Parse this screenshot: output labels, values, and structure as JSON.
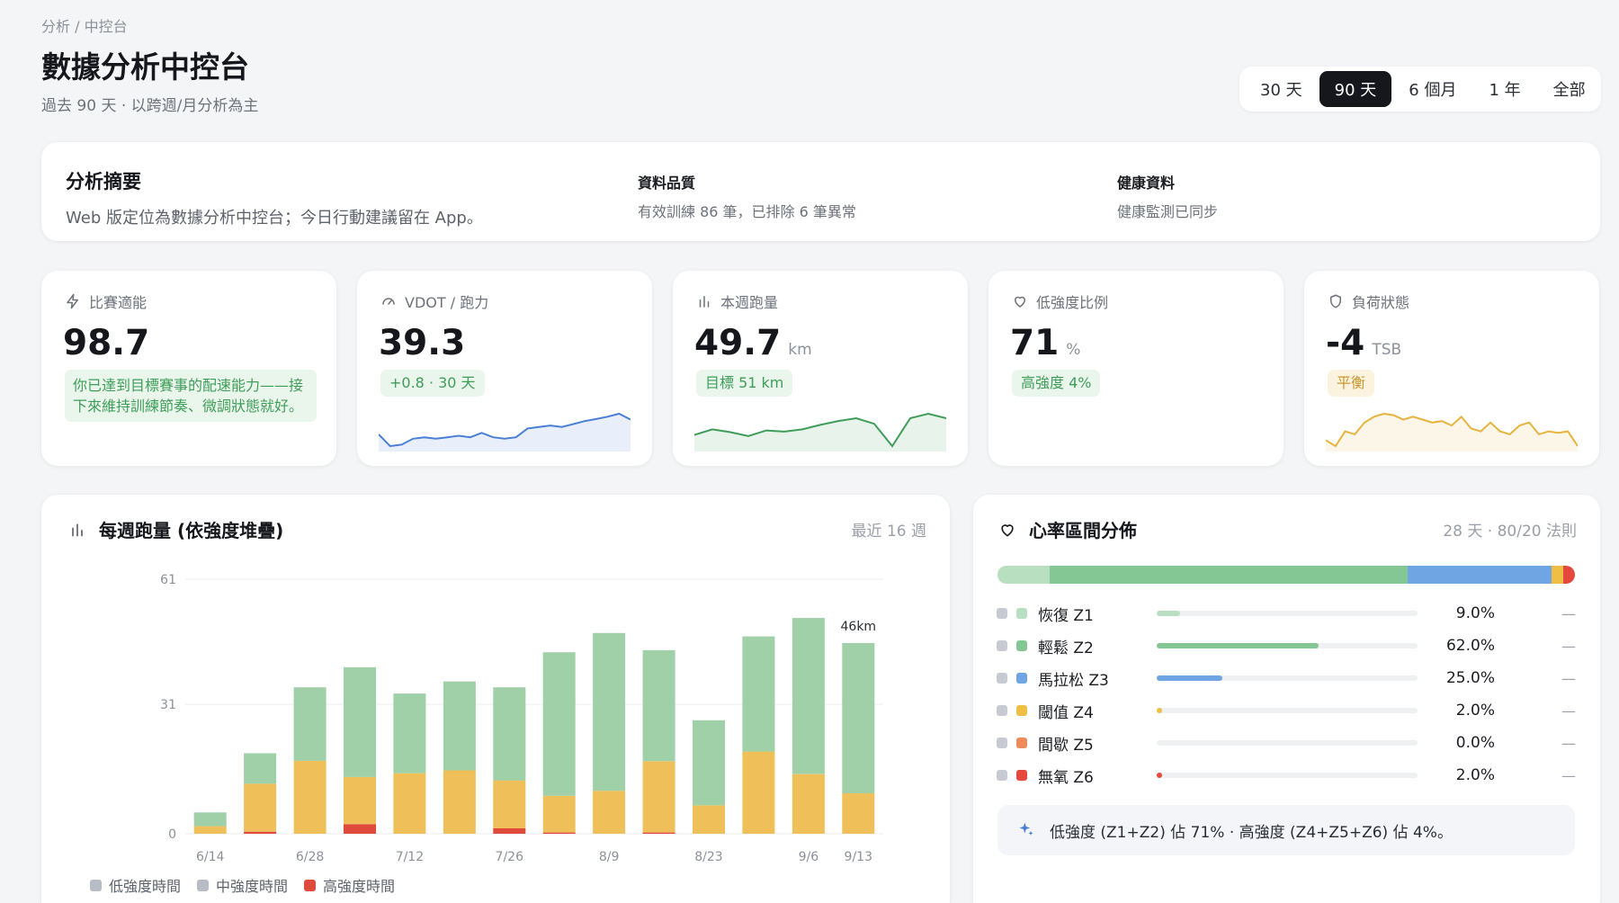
{
  "header": {
    "breadcrumb": "分析 / 中控台",
    "title": "數據分析中控台",
    "subtitle": "過去 90 天 · 以跨週/月分析為主"
  },
  "range": {
    "options": [
      "30 天",
      "90 天",
      "6 個月",
      "1 年",
      "全部"
    ],
    "selected": "90 天"
  },
  "summary": {
    "title": "分析摘要",
    "body": "Web 版定位為數據分析中控台；今日行動建議留在 App。",
    "quality_title": "資料品質",
    "quality_body": "有效訓練 86 筆，已排除 6 筆異常",
    "health_title": "健康資料",
    "health_body": "健康監測已同步"
  },
  "kpis": [
    {
      "icon": "bolt-icon",
      "label": "比賽適能",
      "value": "98.7",
      "unit": "",
      "badge": "你已達到目標賽事的配速能力——接下來維持訓練節奏、微調狀態就好。",
      "color": "#3f9d5a",
      "spark": []
    },
    {
      "icon": "gauge-icon",
      "label": "VDOT / 跑力",
      "value": "39.3",
      "unit": "",
      "badge": "+0.8 · 30 天",
      "color": "#4a7fd6",
      "spark": [
        38.6,
        38.2,
        38.25,
        38.45,
        38.5,
        38.45,
        38.5,
        38.55,
        38.5,
        38.65,
        38.5,
        38.45,
        38.5,
        38.8,
        38.85,
        38.9,
        38.85,
        38.95,
        39.05,
        39.12,
        39.2,
        39.3,
        39.1
      ]
    },
    {
      "icon": "bars-icon",
      "label": "本週跑量",
      "value": "49.7",
      "unit": "km",
      "badge": "目標 51 km",
      "color": "#3f9d5a",
      "spark": [
        46,
        47,
        46.5,
        45.8,
        46.8,
        46.6,
        47,
        47.8,
        48.5,
        49,
        48,
        44,
        49,
        49.8,
        49
      ]
    },
    {
      "icon": "heart-icon",
      "label": "低強度比例",
      "value": "71",
      "unit": "%",
      "badge": "高強度 4%",
      "color": "#3f9d5a",
      "spark": []
    },
    {
      "icon": "shield-icon",
      "label": "負荷狀態",
      "value": "-4",
      "unit": "TSB",
      "badge": "平衡",
      "color": "#e7b33f",
      "spark": [
        0,
        -2,
        3,
        2,
        6,
        8,
        9,
        8.5,
        7,
        8,
        7,
        6,
        6.5,
        5,
        8,
        4,
        3,
        6,
        3,
        2,
        5,
        6,
        2,
        3,
        2.5,
        3,
        -2
      ]
    }
  ],
  "weekly_chart": {
    "title": "每週跑量 (依強度堆疊)",
    "meta": "最近 16 週",
    "annotation": "46km",
    "legend": [
      {
        "label": "低強度時間",
        "color": "#b8bcc4"
      },
      {
        "label": "中強度時間",
        "color": "#b8bcc4"
      },
      {
        "label": "高強度時間",
        "color": "#de4a3c"
      }
    ]
  },
  "chart_data": {
    "type": "bar",
    "stacked": true,
    "categories": [
      "6/14",
      "6/21",
      "6/28",
      "7/5",
      "7/12",
      "7/19",
      "7/26",
      "8/2",
      "8/9",
      "8/16",
      "8/23",
      "8/30",
      "9/6",
      "9/13"
    ],
    "tick_labels": [
      "6/14",
      "6/28",
      "7/12",
      "7/26",
      "8/9",
      "8/23",
      "9/6",
      "9/13"
    ],
    "series": [
      {
        "name": "高強度時間",
        "color": "#de4a3c",
        "values": [
          0,
          0.5,
          0,
          2.3,
          0,
          0,
          1.3,
          0.3,
          0,
          0.3,
          0,
          0,
          0,
          0
        ]
      },
      {
        "name": "中強度時間",
        "color": "#efc05a",
        "values": [
          1.8,
          11.5,
          17.5,
          11.3,
          14.5,
          15.2,
          11.5,
          8.8,
          10.3,
          17.1,
          6.8,
          19.7,
          14.3,
          9.7
        ]
      },
      {
        "name": "低強度時間",
        "color": "#9fd0a8",
        "values": [
          3.3,
          7.3,
          17.6,
          26.3,
          19.1,
          21.3,
          22.3,
          34.4,
          37.8,
          26.6,
          20.4,
          27.6,
          37.4,
          36.0
        ]
      }
    ],
    "ylim": [
      0,
      61
    ],
    "yticks": [
      0,
      31,
      61
    ],
    "grid": true,
    "legend_position": "bottom-left"
  },
  "hr_zones": {
    "title": "心率區間分佈",
    "meta": "28 天 · 80/20 法則",
    "zones": [
      {
        "label": "恢復 Z1",
        "pct": "9.0%",
        "value": 9,
        "color": "#b8dfc0",
        "trend": "—"
      },
      {
        "label": "輕鬆 Z2",
        "pct": "62.0%",
        "value": 62,
        "color": "#84c794",
        "trend": "—"
      },
      {
        "label": "馬拉松 Z3",
        "pct": "25.0%",
        "value": 25,
        "color": "#6ea5e2",
        "trend": "—"
      },
      {
        "label": "閾值 Z4",
        "pct": "2.0%",
        "value": 2,
        "color": "#efbf45",
        "trend": "—"
      },
      {
        "label": "間歇 Z5",
        "pct": "0.0%",
        "value": 0,
        "color": "#ef8a5a",
        "trend": "—"
      },
      {
        "label": "無氧 Z6",
        "pct": "2.0%",
        "value": 2,
        "color": "#e5483c",
        "trend": "—"
      }
    ],
    "insight": "低強度 (Z1+Z2) 佔 71% · 高強度 (Z4+Z5+Z6) 佔 4%。"
  }
}
